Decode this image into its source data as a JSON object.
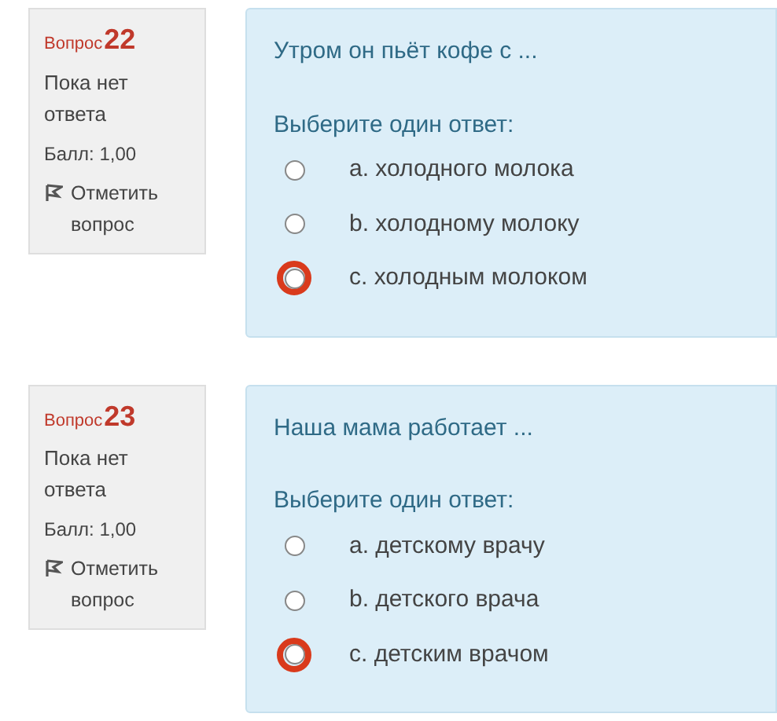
{
  "questions": [
    {
      "label": "Вопрос",
      "number": "22",
      "status": "Пока нет ответа",
      "score": "Балл: 1,00",
      "flag": "Отметить вопрос",
      "text": "Утром он пьёт кофе с ...",
      "prompt": "Выберите один ответ:",
      "options": [
        {
          "label": "a. холодного молока",
          "selected": false,
          "highlighted": false
        },
        {
          "label": "b. холодному молоку",
          "selected": false,
          "highlighted": false
        },
        {
          "label": "c. холодным молоком",
          "selected": false,
          "highlighted": true
        }
      ]
    },
    {
      "label": "Вопрос",
      "number": "23",
      "status": "Пока нет ответа",
      "score": "Балл: 1,00",
      "flag": "Отметить вопрос",
      "text": "Наша мама работает ...",
      "prompt": "Выберите один ответ:",
      "options": [
        {
          "label": "a. детскому врачу",
          "selected": false,
          "highlighted": false
        },
        {
          "label": "b. детского врача",
          "selected": false,
          "highlighted": false
        },
        {
          "label": "c. детским врачом",
          "selected": false,
          "highlighted": true
        }
      ]
    }
  ]
}
